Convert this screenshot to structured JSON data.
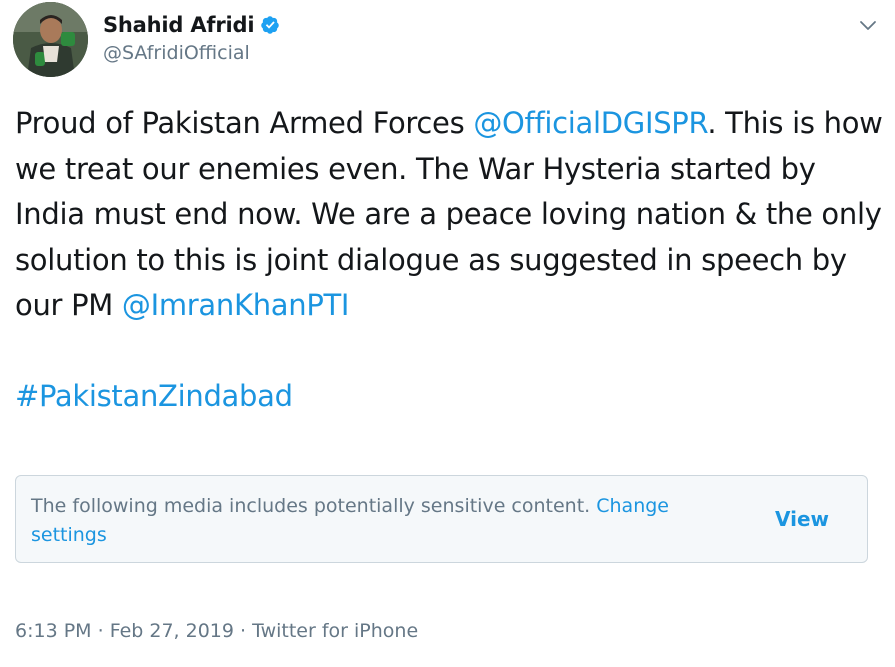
{
  "user": {
    "display_name": "Shahid Afridi",
    "handle": "@SAfridiOfficial",
    "verified": true,
    "avatar_icon": "avatar-photo"
  },
  "tweet": {
    "segments": [
      {
        "text": "Proud of Pakistan Armed Forces ",
        "type": "text"
      },
      {
        "text": "@OfficialDGISPR",
        "type": "mention"
      },
      {
        "text": ". This is how we treat our enemies even. The War Hysteria started by India must end now. We are a peace loving nation & the only solution to this is joint dialogue as suggested in speech by our PM ",
        "type": "text"
      },
      {
        "text": "@ImranKhanPTI",
        "type": "mention"
      }
    ],
    "hashtag": "#PakistanZindabad"
  },
  "sensitive_notice": {
    "text": "The following media includes potentially sensitive content. ",
    "link_label": "Change settings",
    "view_label": "View"
  },
  "meta": {
    "time": "6:13 PM",
    "separator": " · ",
    "date": "Feb 27, 2019",
    "source": "Twitter for iPhone"
  },
  "colors": {
    "link": "#1b95e0",
    "secondary": "#657786",
    "text": "#14171a",
    "verified_badge": "#1da1f2"
  }
}
